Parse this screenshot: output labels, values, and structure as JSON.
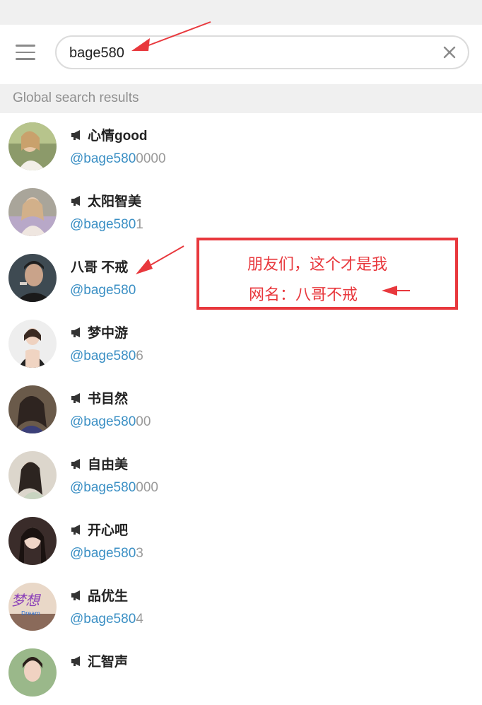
{
  "header": {
    "search_value": "bage580"
  },
  "section": {
    "title": "Global search results"
  },
  "results": [
    {
      "name": "心情good",
      "handle_match": "@bage580",
      "handle_rest": "0000",
      "is_channel": true
    },
    {
      "name": "太阳智美",
      "handle_match": "@bage580",
      "handle_rest": "1",
      "is_channel": true
    },
    {
      "name": "八哥 不戒",
      "handle_match": "@bage580",
      "handle_rest": "",
      "is_channel": false
    },
    {
      "name": "梦中游",
      "handle_match": "@bage580",
      "handle_rest": "6",
      "is_channel": true
    },
    {
      "name": "书目然",
      "handle_match": "@bage580",
      "handle_rest": "00",
      "is_channel": true
    },
    {
      "name": "自由美",
      "handle_match": "@bage580",
      "handle_rest": "000",
      "is_channel": true
    },
    {
      "name": "开心吧",
      "handle_match": "@bage580",
      "handle_rest": "3",
      "is_channel": true
    },
    {
      "name": "品优生",
      "handle_match": "@bage580",
      "handle_rest": "4",
      "is_channel": true
    },
    {
      "name": "汇智声",
      "handle_match": "",
      "handle_rest": "",
      "is_channel": true
    }
  ],
  "annotation": {
    "line1": "朋友们，这个才是我",
    "line2": "网名：八哥不戒",
    "color": "#e8383d"
  },
  "avatar_text": {
    "dream_main": "梦想",
    "dream_sub": "Dream"
  },
  "colors": {
    "link": "#3a8fc4",
    "muted": "#9a9a9a",
    "section_bg": "#f0f0f0"
  }
}
